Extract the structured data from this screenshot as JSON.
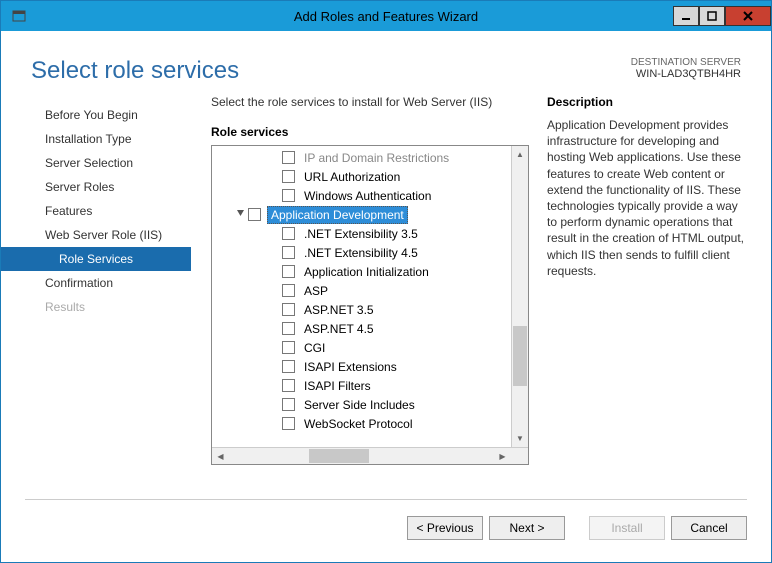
{
  "titlebar": {
    "title": "Add Roles and Features Wizard"
  },
  "header": {
    "title": "Select role services",
    "dest_label": "DESTINATION SERVER",
    "dest_server": "WIN-LAD3QTBH4HR"
  },
  "nav": {
    "items": [
      {
        "label": "Before You Begin"
      },
      {
        "label": "Installation Type"
      },
      {
        "label": "Server Selection"
      },
      {
        "label": "Server Roles"
      },
      {
        "label": "Features"
      },
      {
        "label": "Web Server Role (IIS)"
      },
      {
        "label": "Role Services",
        "sub": true,
        "selected": true
      },
      {
        "label": "Confirmation"
      },
      {
        "label": "Results",
        "disabled": true
      }
    ]
  },
  "content": {
    "instruction": "Select the role services to install for Web Server (IIS)",
    "tree_label": "Role services",
    "tree": [
      {
        "label": "IP and Domain Restrictions",
        "indent": "indent2",
        "dim": true
      },
      {
        "label": "URL Authorization",
        "indent": "indent2"
      },
      {
        "label": "Windows Authentication",
        "indent": "indent2"
      },
      {
        "label": "Application Development",
        "indent": "indent-header",
        "expander": "▱",
        "selected": true
      },
      {
        "label": ".NET Extensibility 3.5",
        "indent": "indent2"
      },
      {
        "label": ".NET Extensibility 4.5",
        "indent": "indent2"
      },
      {
        "label": "Application Initialization",
        "indent": "indent2"
      },
      {
        "label": "ASP",
        "indent": "indent2"
      },
      {
        "label": "ASP.NET 3.5",
        "indent": "indent2"
      },
      {
        "label": "ASP.NET 4.5",
        "indent": "indent2"
      },
      {
        "label": "CGI",
        "indent": "indent2"
      },
      {
        "label": "ISAPI Extensions",
        "indent": "indent2"
      },
      {
        "label": "ISAPI Filters",
        "indent": "indent2"
      },
      {
        "label": "Server Side Includes",
        "indent": "indent2"
      },
      {
        "label": "WebSocket Protocol",
        "indent": "indent2"
      }
    ]
  },
  "description": {
    "title": "Description",
    "text": "Application Development provides infrastructure for developing and hosting Web applications. Use these features to create Web content or extend the functionality of IIS. These technologies typically provide a way to perform dynamic operations that result in the creation of HTML output, which IIS then sends to fulfill client requests."
  },
  "footer": {
    "previous": "< Previous",
    "next": "Next >",
    "install": "Install",
    "cancel": "Cancel"
  }
}
